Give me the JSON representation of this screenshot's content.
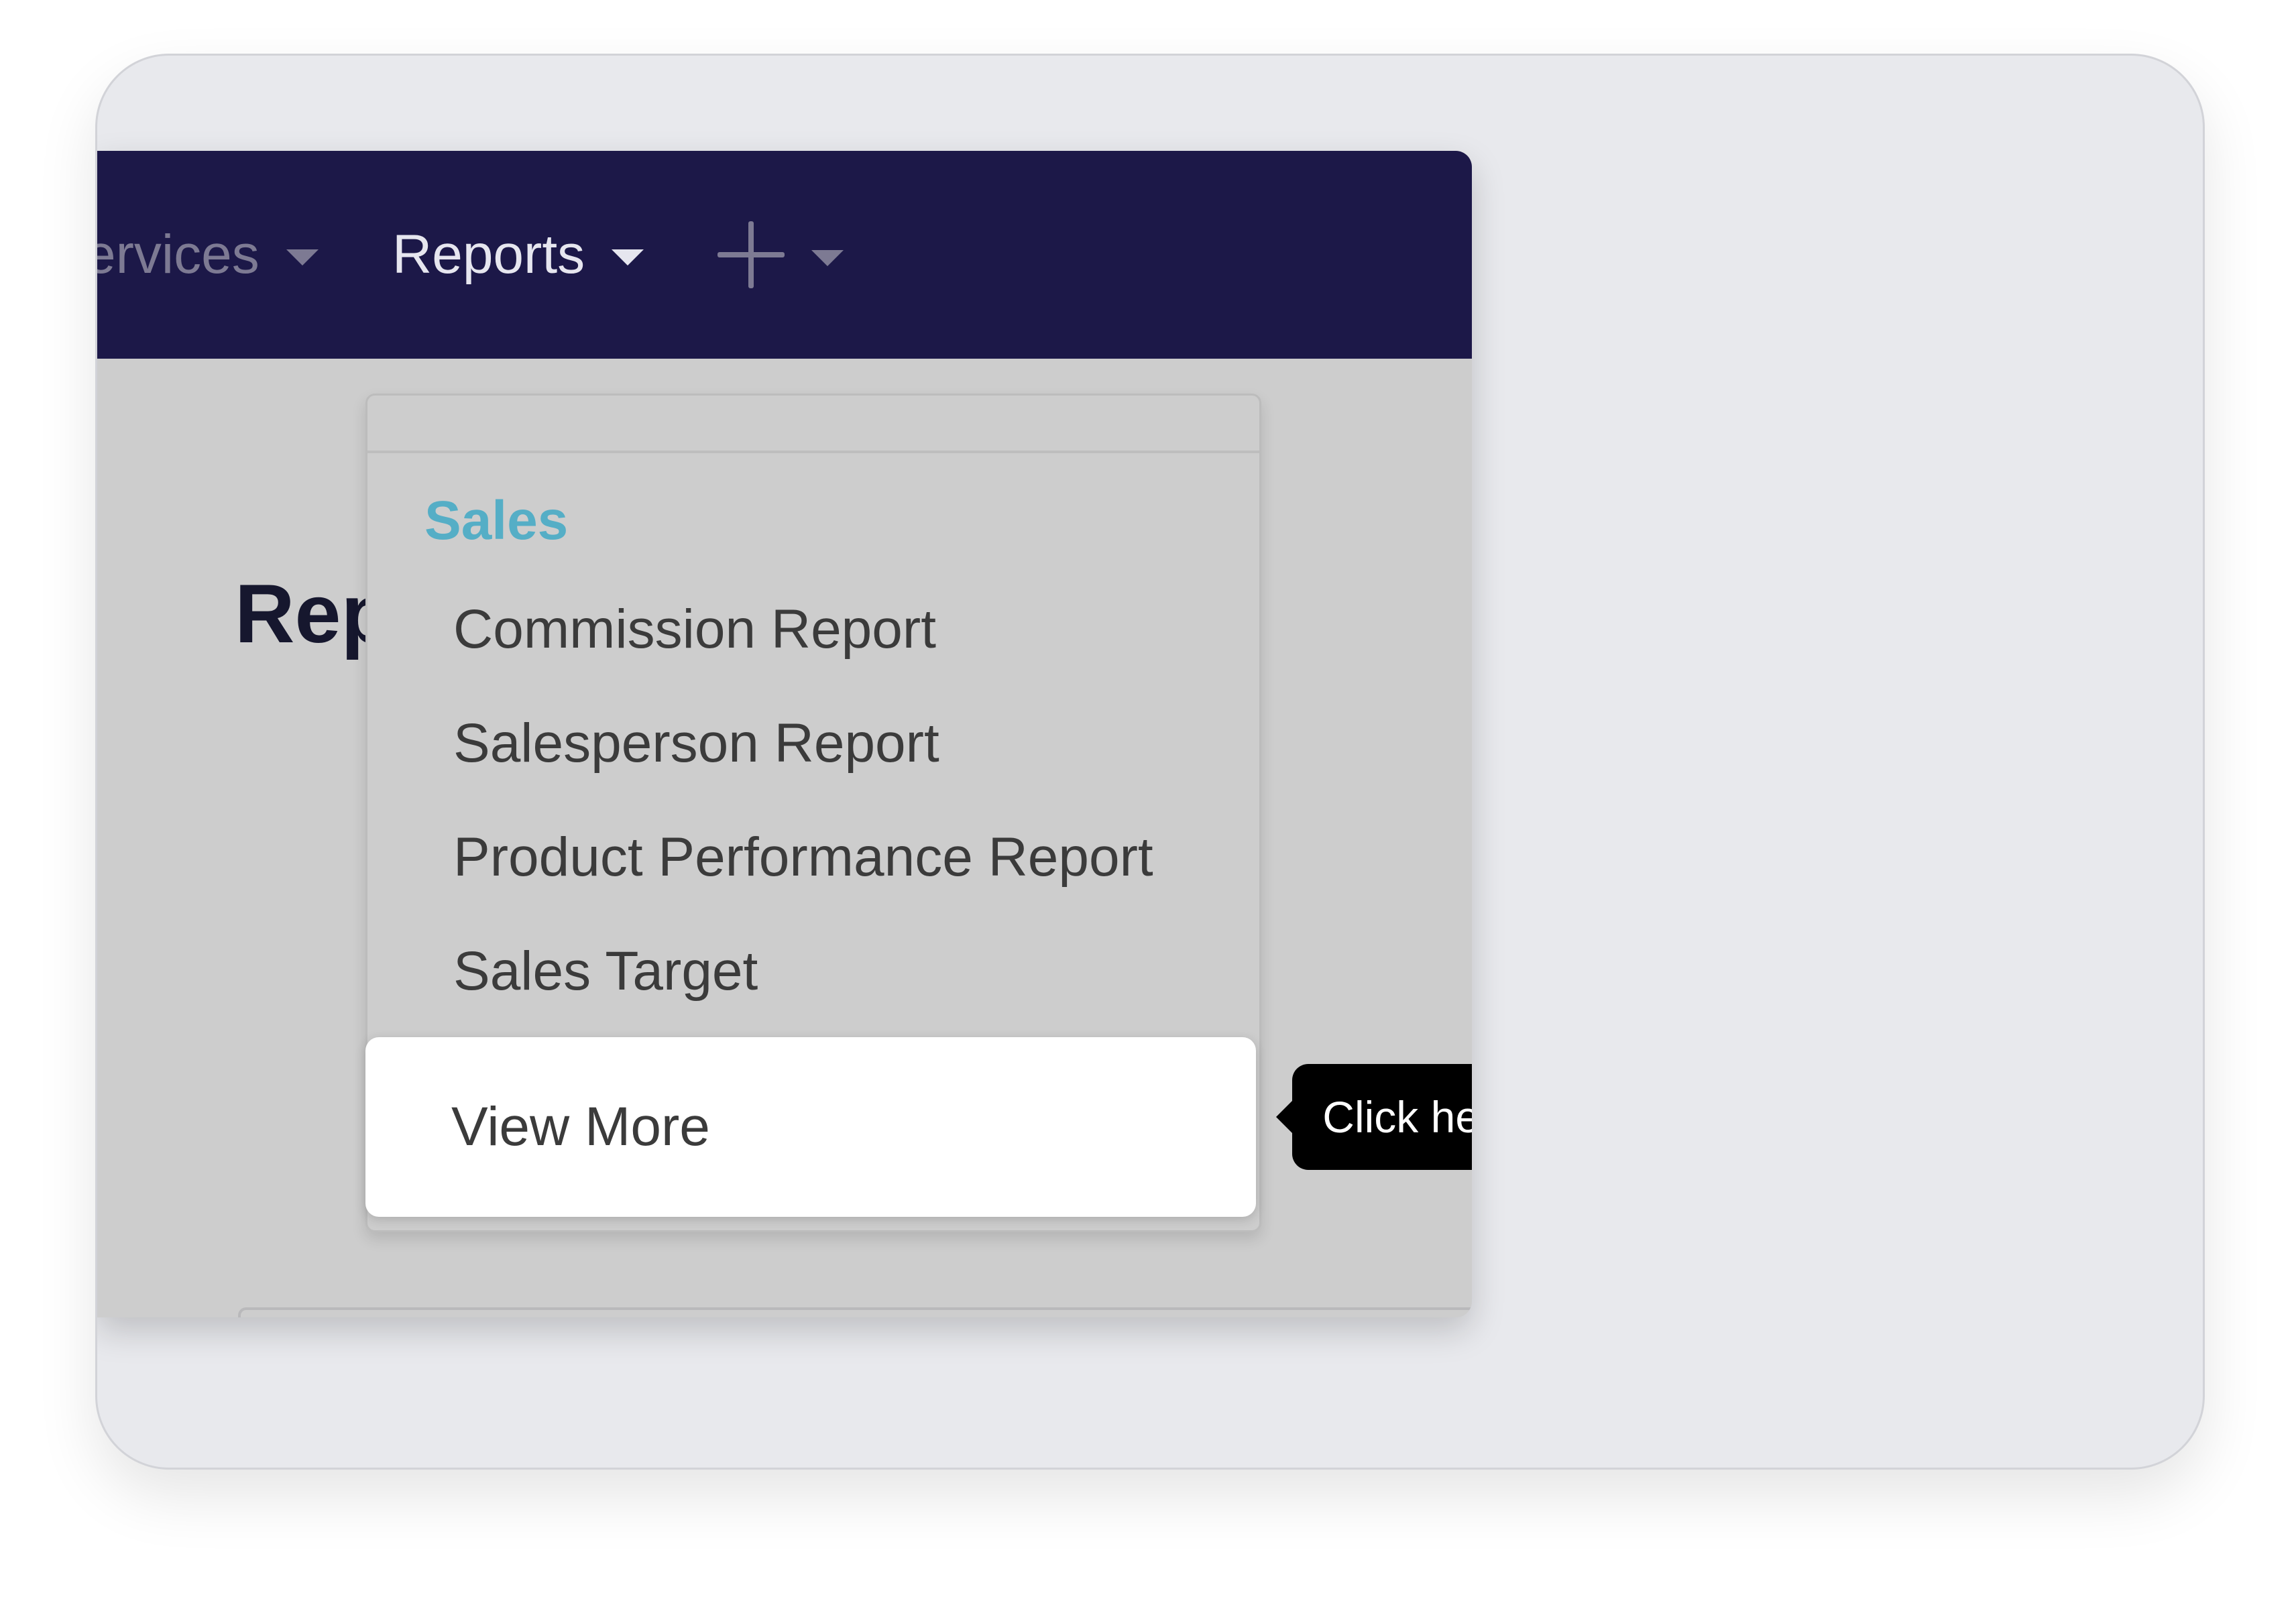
{
  "navbar": {
    "services_label": "ervices",
    "reports_label": "Reports",
    "add_icon": "plus-icon"
  },
  "page": {
    "title": "Rep"
  },
  "dropdown": {
    "heading": "Sales",
    "items": [
      {
        "label": "Commission Report"
      },
      {
        "label": "Salesperson Report"
      },
      {
        "label": "Product Performance Report"
      },
      {
        "label": "Sales Target"
      }
    ],
    "view_more_label": "View More"
  },
  "tooltip": {
    "text": "Click here"
  },
  "colors": {
    "navbar_bg": "#1c1848",
    "heading_accent": "#55aec6",
    "tooltip_bg": "#000000",
    "card_bg": "#e8e9ed"
  }
}
